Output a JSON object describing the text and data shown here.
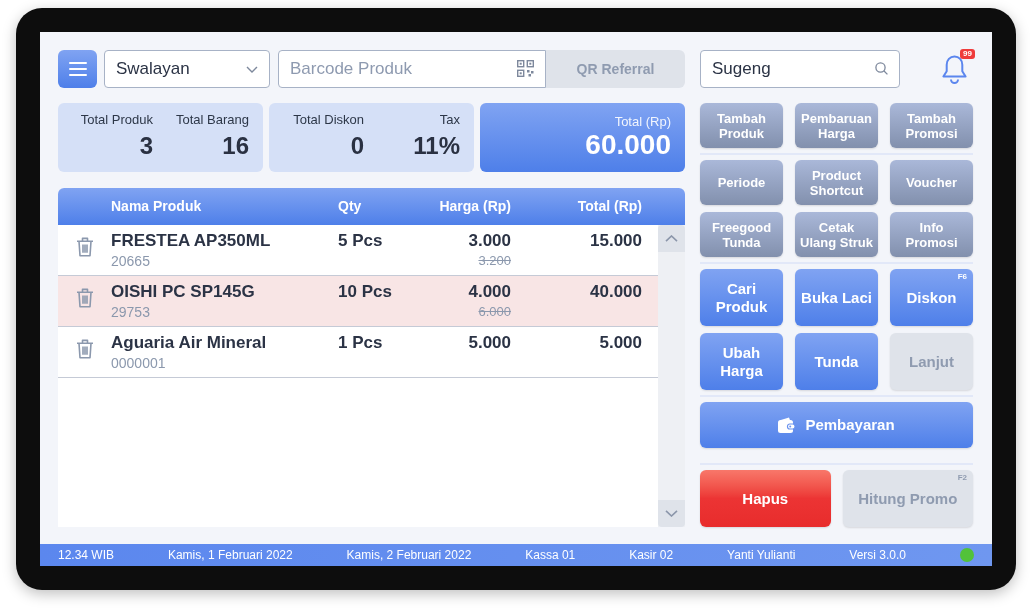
{
  "toolbar": {
    "store_select": {
      "value": "Swalayan"
    },
    "barcode_field": {
      "placeholder": "Barcode Produk"
    },
    "qr_referral_button": {
      "label": "QR Referral",
      "disabled": true
    },
    "customer_search": {
      "value": "Sugeng"
    },
    "notifications": {
      "badge": "99"
    }
  },
  "summary": {
    "cards": [
      {
        "items": [
          {
            "label": "Total Produk",
            "value": "3"
          },
          {
            "label": "Total Barang",
            "value": "16"
          }
        ]
      },
      {
        "items": [
          {
            "label": "Total Diskon",
            "value": "0"
          },
          {
            "label": "Tax",
            "value": "11%"
          }
        ]
      }
    ],
    "total": {
      "label": "Total (Rp)",
      "value": "60.000"
    }
  },
  "table": {
    "columns": [
      "Nama Produk",
      "Qty",
      "Harga (Rp)",
      "Total (Rp)"
    ],
    "rows": [
      {
        "name": "FRESTEA AP350ML",
        "code": "20665",
        "qty": "5 Pcs",
        "price": "3.000",
        "original_price": "3.200",
        "total": "15.000",
        "selected": false
      },
      {
        "name": "OISHI PC SP145G",
        "code": "29753",
        "qty": "10 Pcs",
        "price": "4.000",
        "original_price": "6.000",
        "total": "40.000",
        "selected": true
      },
      {
        "name": "Aguaria Air Mineral",
        "code": "0000001",
        "qty": "1 Pcs",
        "price": "5.000",
        "total": "5.000",
        "selected": false
      }
    ]
  },
  "actions": {
    "groups": [
      {
        "buttons": [
          {
            "label": "Tambah Produk",
            "kind": "secondary",
            "disabled": false
          },
          {
            "label": "Pembaruan Harga",
            "kind": "secondary",
            "disabled": false
          },
          {
            "label": "Tambah Promosi",
            "kind": "secondary",
            "disabled": false
          }
        ]
      },
      {
        "buttons": [
          {
            "label": "Periode",
            "kind": "secondary",
            "disabled": false
          },
          {
            "label": "Product Shortcut",
            "kind": "secondary",
            "disabled": false
          },
          {
            "label": "Voucher",
            "kind": "secondary",
            "disabled": false
          },
          {
            "label": "Freegood Tunda",
            "kind": "secondary",
            "disabled": false
          },
          {
            "label": "Cetak\nUlang Struk",
            "kind": "secondary",
            "disabled": false
          },
          {
            "label": "Info Promosi",
            "kind": "secondary",
            "disabled": false
          }
        ]
      },
      {
        "buttons": [
          {
            "label": "Cari Produk",
            "kind": "primary",
            "disabled": false
          },
          {
            "label": "Buka Laci",
            "kind": "primary",
            "disabled": false
          },
          {
            "label": "Diskon",
            "kind": "primary",
            "disabled": false,
            "shortcut": "F6"
          },
          {
            "label": "Ubah Harga",
            "kind": "primary",
            "disabled": false
          },
          {
            "label": "Tunda",
            "kind": "primary",
            "disabled": false
          },
          {
            "label": "Lanjut",
            "kind": "primary",
            "disabled": true
          }
        ]
      },
      {
        "buttons": [
          {
            "label": "Pembayaran",
            "kind": "payment",
            "disabled": false
          }
        ]
      },
      {
        "buttons": [
          {
            "label": "Hapus",
            "kind": "danger",
            "disabled": false
          },
          {
            "label": "Hitung Promo",
            "kind": "primary",
            "disabled": true,
            "shortcut": "F2"
          }
        ]
      }
    ]
  },
  "status_bar": {
    "items": [
      "12.34 WIB",
      "Kamis, 1 Februari 2022",
      "Kamis, 2 Februari 2022",
      "Kassa 01",
      "Kasir 02",
      "Yanti Yulianti",
      "Versi 3.0.0"
    ],
    "online": true
  }
}
